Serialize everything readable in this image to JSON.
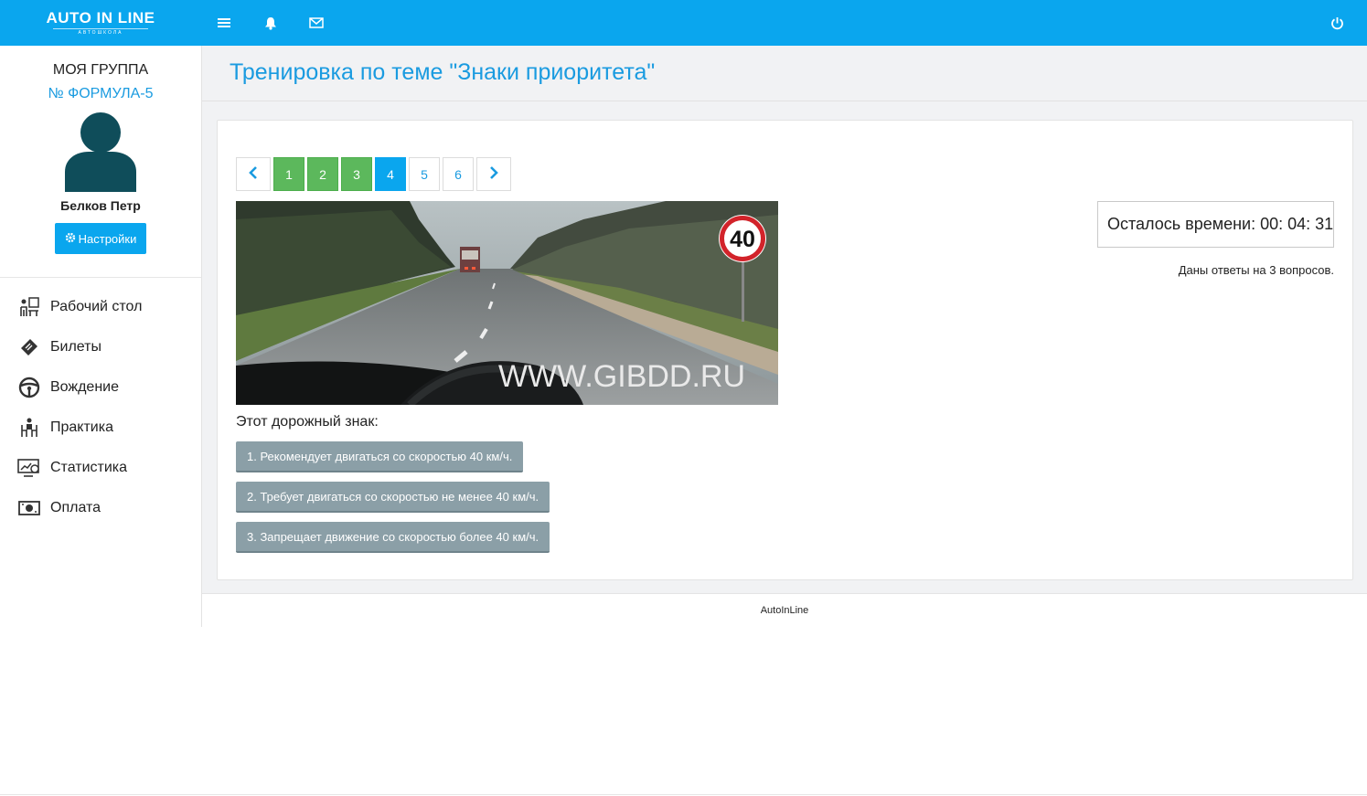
{
  "app": {
    "brand": "AUTO IN LINE",
    "brand_sub": "АВТОШКОЛА",
    "accent_color": "#0aa6ee"
  },
  "topbar": {
    "icons": [
      "menu-icon",
      "bell-icon",
      "mail-icon",
      "power-icon"
    ]
  },
  "sidebar": {
    "group_title": "МОЯ ГРУППА",
    "group_name": "№ ФОРМУЛА-5",
    "user_name": "Белков Петр",
    "settings_label": "Настройки",
    "items": [
      {
        "label": "Рабочий стол",
        "icon": "desk-icon"
      },
      {
        "label": "Билеты",
        "icon": "ticket-icon"
      },
      {
        "label": "Вождение",
        "icon": "steering-wheel-icon"
      },
      {
        "label": "Практика",
        "icon": "practice-icon"
      },
      {
        "label": "Статистика",
        "icon": "statistics-icon"
      },
      {
        "label": "Оплата",
        "icon": "payment-icon"
      }
    ]
  },
  "main": {
    "title": "Тренировка по теме \"Знаки приоритета\"",
    "pager": {
      "pages": [
        "1",
        "2",
        "3",
        "4",
        "5",
        "6"
      ],
      "current": "4",
      "answered_pages": [
        "1",
        "2",
        "3"
      ]
    },
    "image": {
      "sign_value": "40",
      "watermark": "WWW.GIBDD.RU"
    },
    "question": "Этот дорожный знак:",
    "answers": [
      "1. Рекомендует двигаться со скоростью 40 км/ч.",
      "2. Требует двигаться со скоростью не менее 40 км/ч.",
      "3. Запрещает движение со скоростью более 40 км/ч."
    ],
    "timer_label": "Осталось времени:",
    "timer_value": "00: 04: 31",
    "answered_text": "Даны ответы на 3 вопросов."
  },
  "footer": {
    "text": "AutoInLine"
  }
}
